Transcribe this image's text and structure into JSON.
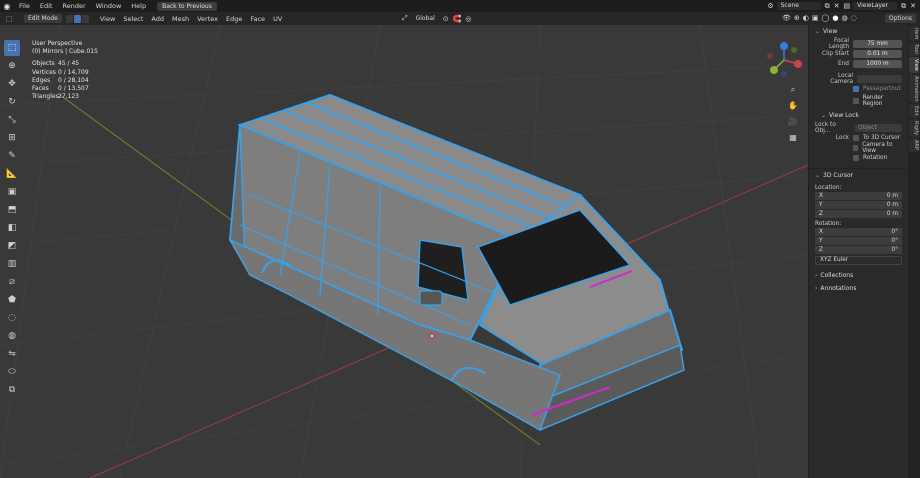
{
  "topbar": {
    "menus": [
      "File",
      "Edit",
      "Render",
      "Window",
      "Help"
    ],
    "back_button": "Back to Previous",
    "scene": "Scene",
    "view_layer": "ViewLayer"
  },
  "header": {
    "mode": "Edit Mode",
    "menus": [
      "View",
      "Select",
      "Add",
      "Mesh",
      "Vertex",
      "Edge",
      "Face",
      "UV"
    ],
    "transform_orientation": "Global",
    "options_label": "Options"
  },
  "viewport": {
    "perspective": "User Perspective",
    "object_name": "(0) Mirrors | Cube.015",
    "stats": [
      {
        "label": "Objects",
        "value": "45 / 45"
      },
      {
        "label": "Vertices",
        "value": "0 / 14,709"
      },
      {
        "label": "Edges",
        "value": "0 / 28,104"
      },
      {
        "label": "Faces",
        "value": "0 / 13,507"
      },
      {
        "label": "Triangles",
        "value": "27,123"
      }
    ]
  },
  "panel": {
    "view_section": "View",
    "focal_length_label": "Focal Length",
    "focal_length": "75 mm",
    "clip_start_label": "Clip Start",
    "clip_start": "0.01 m",
    "clip_end_label": "End",
    "clip_end": "1000 m",
    "local_camera_label": "Local Camera",
    "passepartout": "Passepartout",
    "render_region": "Render Region",
    "view_lock_section": "View Lock",
    "lock_to_object_label": "Lock to Obj...",
    "lock_object_placeholder": "Object",
    "lock_label": "Lock",
    "to_3d_cursor": "To 3D Cursor",
    "camera_to_view": "Camera to View",
    "rotation_check": "Rotation",
    "cursor_section": "3D Cursor",
    "location_label": "Location:",
    "location": [
      {
        "axis": "X",
        "value": "0 m"
      },
      {
        "axis": "Y",
        "value": "0 m"
      },
      {
        "axis": "Z",
        "value": "0 m"
      }
    ],
    "rotation_label": "Rotation:",
    "rotation": [
      {
        "axis": "X",
        "value": "0°"
      },
      {
        "axis": "Y",
        "value": "0°"
      },
      {
        "axis": "Z",
        "value": "0°"
      }
    ],
    "rotation_mode": "XYZ Euler",
    "collections_section": "Collections",
    "annotations_section": "Annotations"
  },
  "side_tabs": [
    "Item",
    "Tool",
    "View",
    "Animation",
    "Edit",
    "Rigify",
    "ARP"
  ],
  "colors": {
    "accent": "#4772b3",
    "wire_selected": "#3aa0e8",
    "axis_x": "#c8454f",
    "axis_y": "#8bb33a"
  }
}
